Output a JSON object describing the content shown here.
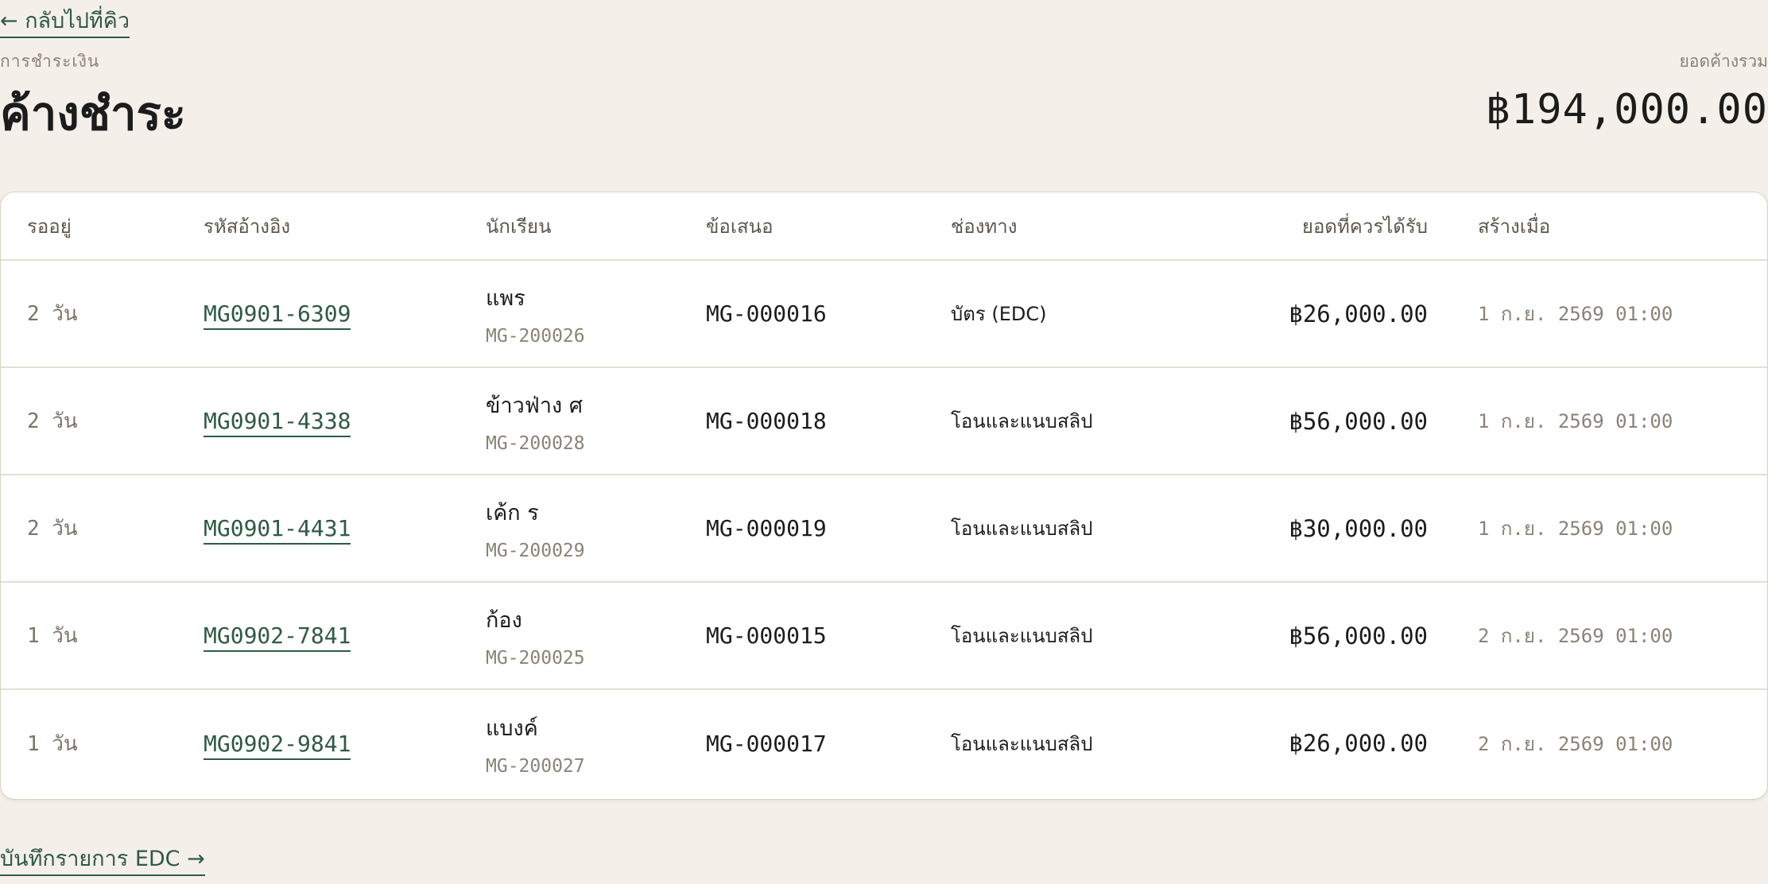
{
  "nav": {
    "back_label": "← กลับไปที่คิว"
  },
  "header": {
    "eyebrow": "การชำระเงิน",
    "title": "ค้างชำระ",
    "total_label": "ยอดค้างรวม",
    "total_value": "฿194,000.00"
  },
  "table": {
    "columns": [
      "รออยู่",
      "รหัสอ้างอิง",
      "นักเรียน",
      "ข้อเสนอ",
      "ช่องทาง",
      "ยอดที่ควรได้รับ",
      "สร้างเมื่อ"
    ],
    "rows": [
      {
        "wait": "2 วัน",
        "ref": "MG0901-6309",
        "student_name": "แพร",
        "student_id": "MG-200026",
        "offer": "MG-000016",
        "channel": "บัตร (EDC)",
        "amount": "฿26,000.00",
        "created": "1 ก.ย. 2569 01:00"
      },
      {
        "wait": "2 วัน",
        "ref": "MG0901-4338",
        "student_name": "ข้าวฟ่าง ศ",
        "student_id": "MG-200028",
        "offer": "MG-000018",
        "channel": "โอนและแนบสลิป",
        "amount": "฿56,000.00",
        "created": "1 ก.ย. 2569 01:00"
      },
      {
        "wait": "2 วัน",
        "ref": "MG0901-4431",
        "student_name": "เค้ก ร",
        "student_id": "MG-200029",
        "offer": "MG-000019",
        "channel": "โอนและแนบสลิป",
        "amount": "฿30,000.00",
        "created": "1 ก.ย. 2569 01:00"
      },
      {
        "wait": "1 วัน",
        "ref": "MG0902-7841",
        "student_name": "ก้อง",
        "student_id": "MG-200025",
        "offer": "MG-000015",
        "channel": "โอนและแนบสลิป",
        "amount": "฿56,000.00",
        "created": "2 ก.ย. 2569 01:00"
      },
      {
        "wait": "1 วัน",
        "ref": "MG0902-9841",
        "student_name": "แบงค์",
        "student_id": "MG-200027",
        "offer": "MG-000017",
        "channel": "โอนและแนบสลิป",
        "amount": "฿26,000.00",
        "created": "2 ก.ย. 2569 01:00"
      }
    ]
  },
  "footer": {
    "edc_label": "บันทึกรายการ EDC →"
  },
  "colors": {
    "background": "#f4f0e9",
    "accent_link": "#2f5a45",
    "muted_text": "#8a8377",
    "border": "#d9d1bf"
  }
}
